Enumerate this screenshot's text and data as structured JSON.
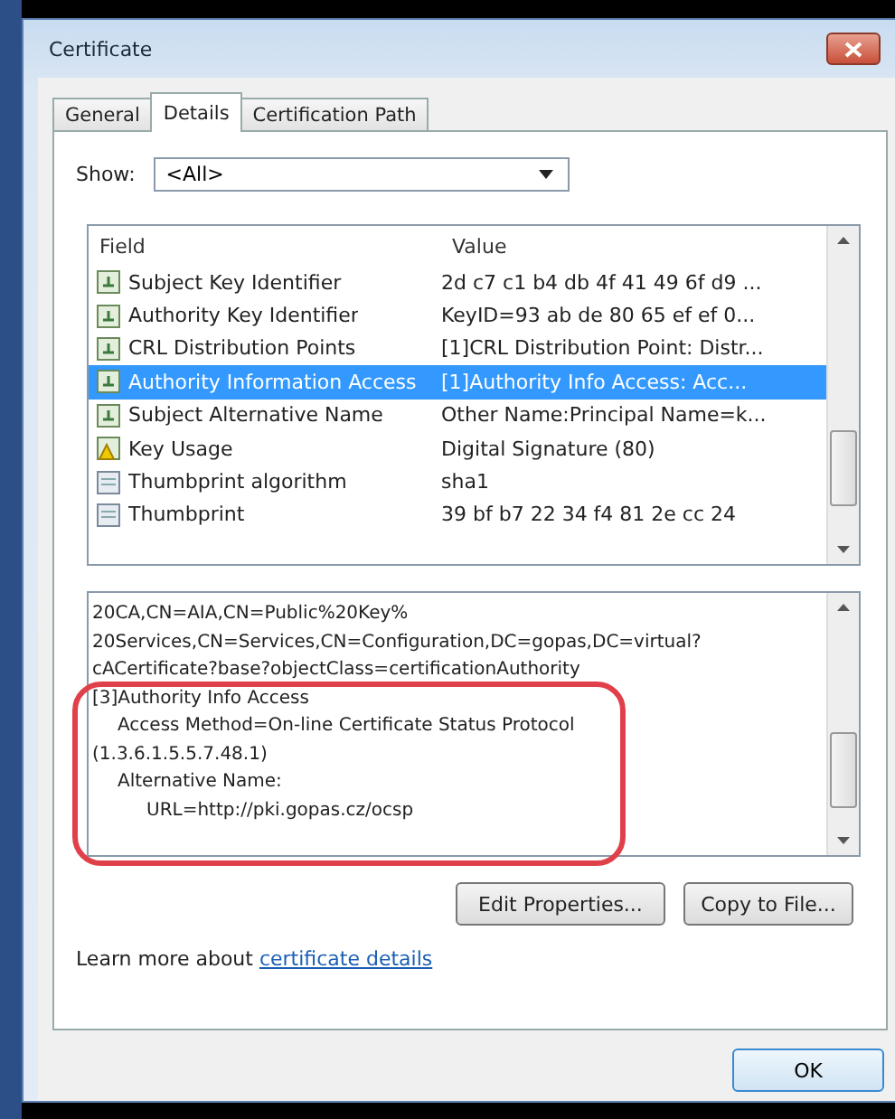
{
  "window": {
    "title": "Certificate"
  },
  "tabs": [
    {
      "label": "General",
      "selected": false
    },
    {
      "label": "Details",
      "selected": true
    },
    {
      "label": "Certification Path",
      "selected": false
    }
  ],
  "show": {
    "label": "Show:",
    "value": "<All>"
  },
  "table": {
    "columns": [
      "Field",
      "Value"
    ],
    "rows": [
      {
        "kind": "extension",
        "field": "Subject Key Identifier",
        "value": "2d c7 c1 b4 db 4f 41 49 6f d9 ...",
        "selected": false
      },
      {
        "kind": "extension",
        "field": "Authority Key Identifier",
        "value": "KeyID=93 ab de 80 65 ef ef 0...",
        "selected": false
      },
      {
        "kind": "extension",
        "field": "CRL Distribution Points",
        "value": "[1]CRL Distribution Point: Distr...",
        "selected": false
      },
      {
        "kind": "extension",
        "field": "Authority Information Access",
        "value": "[1]Authority Info Access: Acc...",
        "selected": true
      },
      {
        "kind": "extension",
        "field": "Subject Alternative Name",
        "value": "Other Name:Principal Name=k...",
        "selected": false
      },
      {
        "kind": "critical",
        "field": "Key Usage",
        "value": "Digital Signature (80)",
        "selected": false
      },
      {
        "kind": "property",
        "field": "Thumbprint algorithm",
        "value": "sha1",
        "selected": false
      },
      {
        "kind": "property",
        "field": "Thumbprint",
        "value": "39 bf b7 22 34 f4 81 2e cc 24",
        "selected": false
      }
    ]
  },
  "details": {
    "lines": [
      {
        "text": "20CA,CN=AIA,CN=Public%20Key%"
      },
      {
        "text": "20Services,CN=Services,CN=Configuration,DC=gopas,DC=virtual?"
      },
      {
        "text": "cACertificate?base?objectClass=certificationAuthority"
      },
      {
        "text": "[3]Authority Info Access",
        "children": [
          {
            "text": "Access Method=On-line Certificate Status Protocol (1.3.6.1.5.5.7.48.1)"
          },
          {
            "text": "Alternative Name:",
            "children": [
              {
                "text": "URL=http://pki.gopas.cz/ocsp"
              }
            ]
          }
        ]
      }
    ]
  },
  "buttons": [
    "Edit Properties...",
    "Copy to File..."
  ],
  "learn_more": {
    "text": "Learn more about ",
    "link": "certificate details"
  },
  "ok_button": "OK"
}
